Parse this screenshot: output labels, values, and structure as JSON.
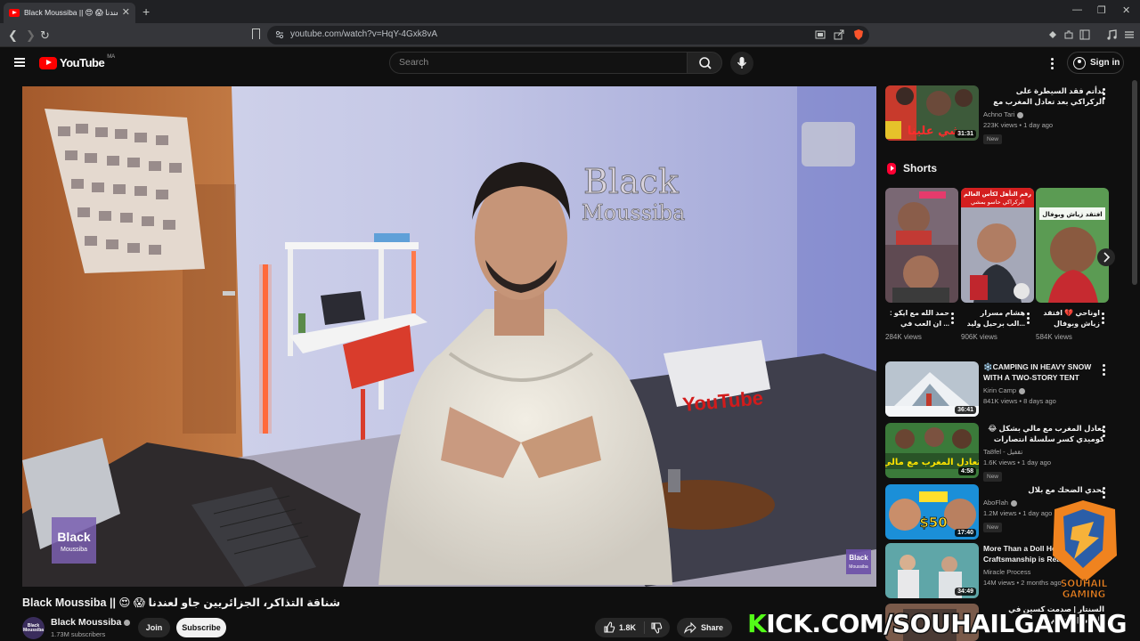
{
  "browser": {
    "tab_title": "Black Moussiba || 😍 😱 لعندنا",
    "url": "youtube.com/watch?v=HqY-4Gxk8vA"
  },
  "header": {
    "logo_text": "YouTube",
    "country_code": "MA",
    "search_placeholder": "Search",
    "signin_label": "Sign in"
  },
  "video": {
    "overlay_wall_text_1": "Black",
    "overlay_wall_text_2": "Moussiba",
    "pillow_text": "YouTube",
    "watermark_1": "Black",
    "watermark_2": "Moussiba",
    "corner_mark_1": "Black",
    "corner_mark_2": "Moussiba",
    "title": "Black Moussiba || 😍 😱 شناقة التذاكر، الجزائريين جاو لعندنا",
    "channel_name": "Black Moussiba",
    "subscribers": "1.73M subscribers",
    "avatar_text": "Black Moussiba",
    "join_label": "Join",
    "subscribe_label": "Subscribe",
    "likes": "1.8K",
    "share_label": "Share"
  },
  "sidebar": {
    "top": {
      "title": "بدأتم فقد السيطرة على الركراكي بعد تعادل المغرب مع مالي ومخيبش أشنو قالو ليه",
      "channel": "Achno Tari",
      "meta": "223K views • 1 day ago",
      "badge": "New",
      "duration": "31:31",
      "thumb_text": "شي علينا"
    },
    "shorts_title": "Shorts",
    "shorts": [
      {
        "title": "حمد الله مع ايكو : ... ان العب في",
        "views": "284K views"
      },
      {
        "title": "هشام مسرار ...الب برحيل وليد",
        "views": "906K views"
      },
      {
        "title": "اوناحي 💔 افتقد زياش وبوفال في...",
        "views": "584K views"
      }
    ],
    "short_labels": [
      "رقم التأهل لكأس العالم",
      "الركراكي حاسو بمشي",
      "افتقد زياش وبوفال"
    ],
    "list": [
      {
        "title": "❄️CAMPING IN HEAVY SNOW WITH A TWO-STORY TENT",
        "channel": "Kirin Camp",
        "meta": "841K views • 8 days ago",
        "badge": "",
        "duration": "36:41"
      },
      {
        "title": "😂 تعادل المغرب مع مالي بشكل كوميدي كسر سلسلة انتصارات المغرب",
        "channel": "Ta8fel - تقفيل",
        "meta": "1.6K views • 1 day ago",
        "badge": "New",
        "duration": "4:58",
        "thumb_text": "تعادل المغرب مع مالي"
      },
      {
        "title": "تحدي الضحك مع بلال",
        "channel": "AboFlah",
        "meta": "1.2M views • 1 day ago",
        "badge": "New",
        "duration": "17:40",
        "thumb_text": "$50"
      },
      {
        "title": "More Than a Doll Ho... Craftsmanship is Rea...",
        "channel": "Miracle Process",
        "meta": "14M views • 2 months ago",
        "badge": "",
        "duration": "34:49"
      },
      {
        "title": "السنتار | صدمت كسين في طفلي | ستريم",
        "channel": "",
        "meta": "",
        "badge": "",
        "duration": ""
      }
    ]
  },
  "overlay": {
    "gaming_line1": "SOUHAIL",
    "gaming_line2": "GAMING",
    "kick_k": "K",
    "kick_rest": "ICK.COM/SOUHAILGAMING"
  },
  "colors": {
    "bg": "#0f0f0f",
    "accent_red": "#ff0000",
    "kick_green": "#53fc18"
  }
}
